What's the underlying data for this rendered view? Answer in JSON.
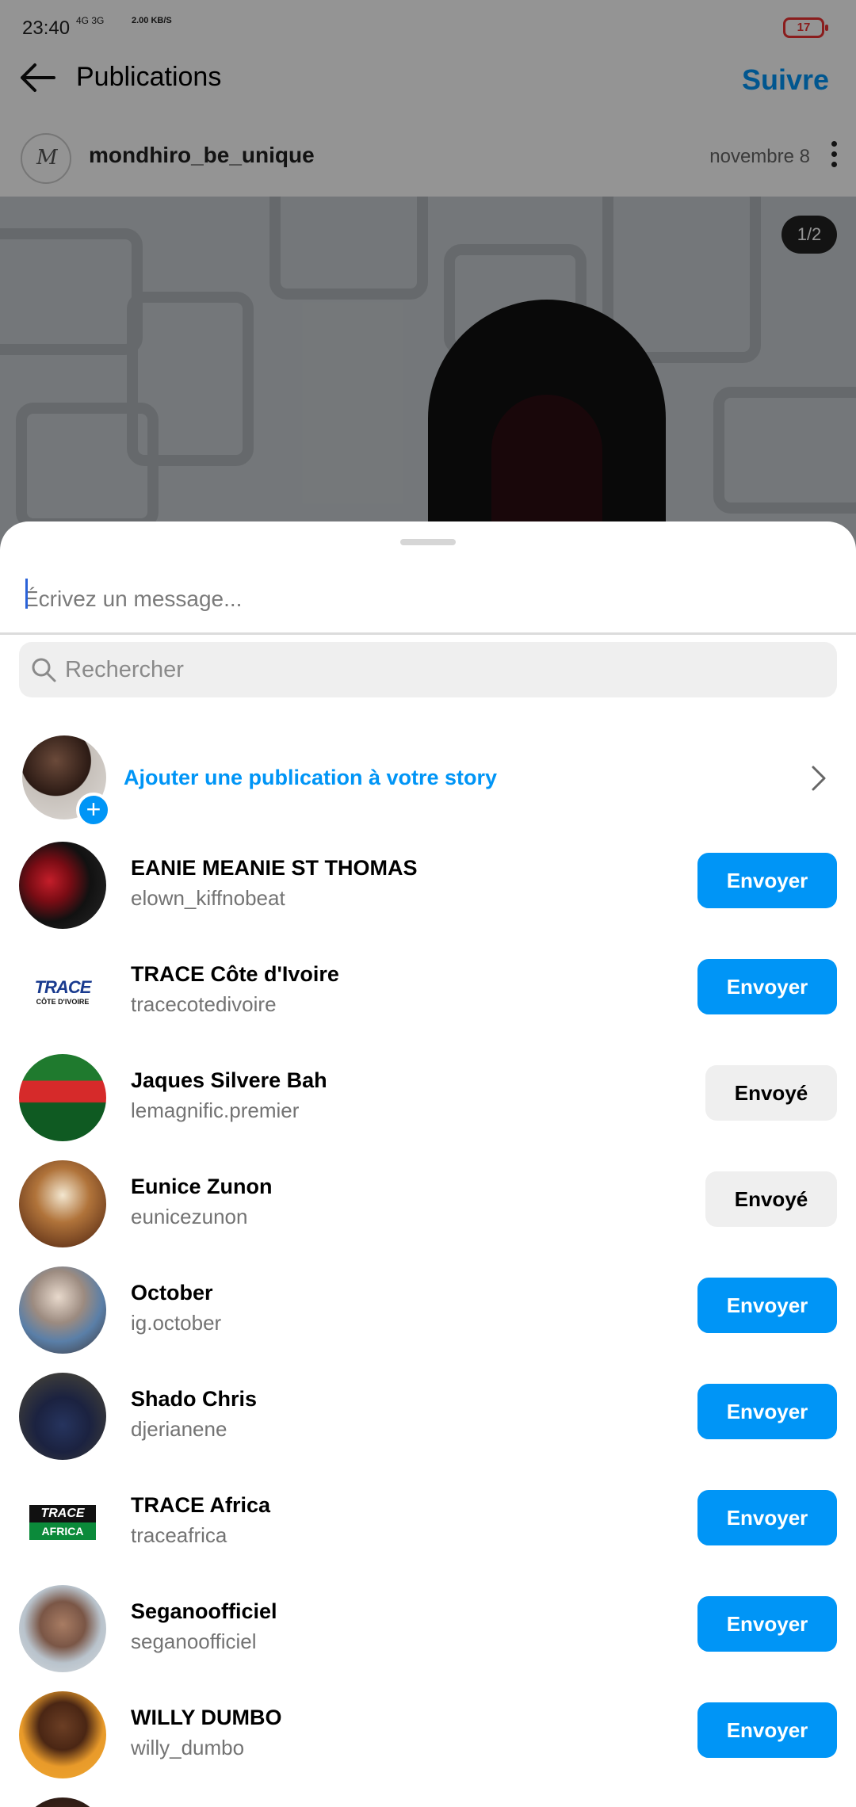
{
  "status_bar": {
    "time": "23:40",
    "network": "4G 3G",
    "speed": "2.00 KB/S",
    "battery": "17"
  },
  "header": {
    "title": "Publications",
    "follow_label": "Suivre"
  },
  "post": {
    "author": "mondhiro_be_unique",
    "date": "novembre 8",
    "page_indicator": "1/2"
  },
  "share_sheet": {
    "message_placeholder": "Écrivez un message...",
    "search_placeholder": "Rechercher",
    "add_to_story_label": "Ajouter une publication à votre story",
    "contacts": [
      {
        "name": "EANIE MEANIE ST THOMAS",
        "handle": "elown_kiffnobeat",
        "action": "Envoyer",
        "sent": false
      },
      {
        "name": "TRACE Côte d'Ivoire",
        "handle": "tracecotedivoire",
        "action": "Envoyer",
        "sent": false
      },
      {
        "name": "Jaques Silvere Bah",
        "handle": "lemagnific.premier",
        "action": "Envoyé",
        "sent": true
      },
      {
        "name": "Eunice Zunon",
        "handle": "eunicezunon",
        "action": "Envoyé",
        "sent": true
      },
      {
        "name": "October",
        "handle": "ig.october",
        "action": "Envoyer",
        "sent": false
      },
      {
        "name": "Shado Chris",
        "handle": "djerianene",
        "action": "Envoyer",
        "sent": false
      },
      {
        "name": "TRACE Africa",
        "handle": "traceafrica",
        "action": "Envoyer",
        "sent": false
      },
      {
        "name": "Seganoofficiel",
        "handle": "seganoofficiel",
        "action": "Envoyer",
        "sent": false
      },
      {
        "name": "WILLY DUMBO",
        "handle": "willy_dumbo",
        "action": "Envoyer",
        "sent": false
      }
    ],
    "logos": {
      "trace_civ_word": "TRACE",
      "trace_civ_sub": "CÔTE D'IVOIRE",
      "trace_africa_top": "TRACE",
      "trace_africa_bottom": "AFRICA"
    }
  },
  "colors": {
    "accent": "#0095f6",
    "sent_button": "#efefef",
    "battery": "#e33333"
  }
}
